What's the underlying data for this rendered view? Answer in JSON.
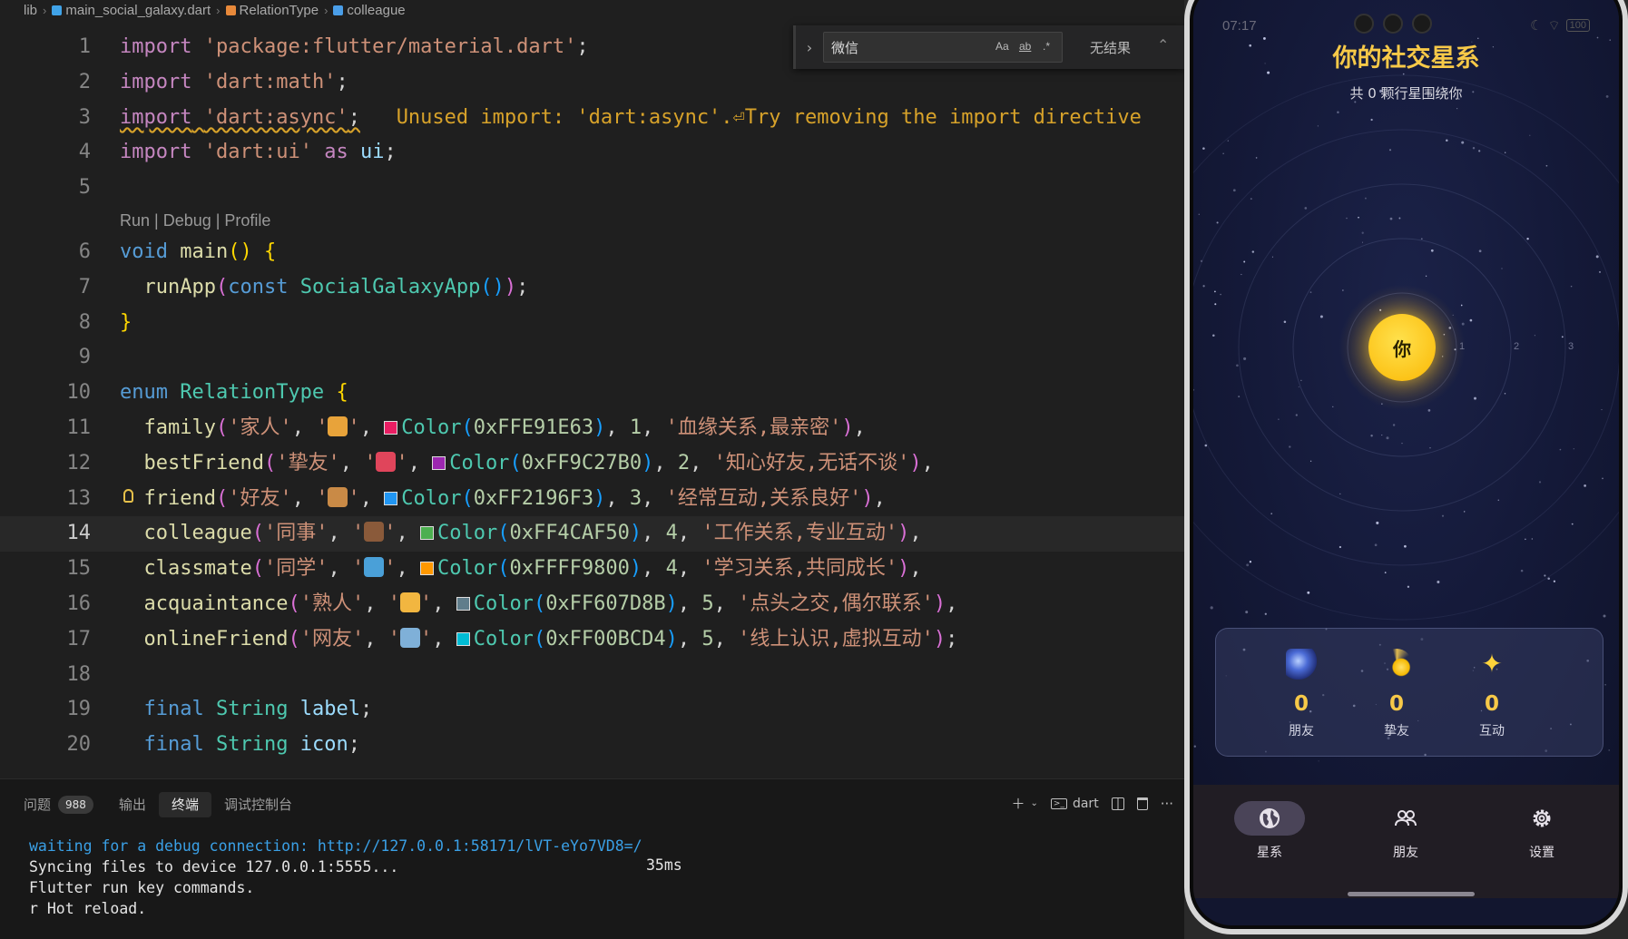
{
  "breadcrumb": [
    "lib",
    "main_social_galaxy.dart",
    "RelationType",
    "colleague"
  ],
  "find": {
    "query": "微信",
    "opt_case": "Aa",
    "opt_word": "ab",
    "opt_regex": ".*",
    "result": "无结果"
  },
  "codelens": "Run | Debug | Profile",
  "line_numbers": [
    "1",
    "2",
    "3",
    "4",
    "5",
    "6",
    "7",
    "8",
    "9",
    "10",
    "11",
    "12",
    "13",
    "14",
    "15",
    "16",
    "17",
    "18",
    "19",
    "20"
  ],
  "code": {
    "l1": "'package:flutter/material.dart'",
    "l2": "'dart:math'",
    "l3": "'dart:async'",
    "l3_diag": "Unused import: 'dart:async'.⏎Try removing the import directive",
    "l4_str": "'dart:ui'",
    "l4_alias": "ui",
    "l6": "main",
    "l7_fn": "runApp",
    "l7_ty": "SocialGalaxyApp",
    "l10_ty": "RelationType",
    "enum_rows": [
      {
        "name": "family",
        "label": "'家人'",
        "color": "0xFFE91E63",
        "hex": "#E91E63",
        "level": "1",
        "desc": "'血缘关系,最亲密'",
        "emoji_bg": "#e8a33a"
      },
      {
        "name": "bestFriend",
        "label": "'挚友'",
        "color": "0xFF9C27B0",
        "hex": "#9C27B0",
        "level": "2",
        "desc": "'知心好友,无话不谈'",
        "emoji_bg": "#e0455b"
      },
      {
        "name": "friend",
        "label": "'好友'",
        "color": "0xFF2196F3",
        "hex": "#2196F3",
        "level": "3",
        "desc": "'经常互动,关系良好'",
        "emoji_bg": "#c98a46"
      },
      {
        "name": "colleague",
        "label": "'同事'",
        "color": "0xFF4CAF50",
        "hex": "#4CAF50",
        "level": "4",
        "desc": "'工作关系,专业互动'",
        "emoji_bg": "#8a5a3a"
      },
      {
        "name": "classmate",
        "label": "'同学'",
        "color": "0xFFFF9800",
        "hex": "#FF9800",
        "level": "4",
        "desc": "'学习关系,共同成长'",
        "emoji_bg": "#4aa0d8"
      },
      {
        "name": "acquaintance",
        "label": "'熟人'",
        "color": "0xFF607D8B",
        "hex": "#607D8B",
        "level": "5",
        "desc": "'点头之交,偶尔联系'",
        "emoji_bg": "#f2b640"
      },
      {
        "name": "onlineFriend",
        "label": "'网友'",
        "color": "0xFF00BCD4",
        "hex": "#00BCD4",
        "level": "5",
        "desc": "'线上认识,虚拟互动'",
        "emoji_bg": "#7fb0d8"
      }
    ],
    "l19": "label",
    "l20": "icon"
  },
  "panel": {
    "tabs": [
      "问题",
      "输出",
      "终端",
      "调试控制台"
    ],
    "problems_count": "988",
    "active_tab": "终端",
    "shell": "dart",
    "term_lines": [
      "waiting for a debug connection: http://127.0.0.1:58171/lVT-eYo7VD8=/",
      "Syncing files to device 127.0.0.1:5555...",
      "",
      "Flutter run key commands.",
      "r Hot reload."
    ],
    "term_timing": "35ms"
  },
  "phone": {
    "time": "07:17",
    "battery": "100",
    "title": "你的社交星系",
    "subtitle": "共 0 颗行星围绕你",
    "sun_label": "你",
    "orbit_labels": [
      "1",
      "2",
      "3"
    ],
    "stats": [
      {
        "value": "0",
        "label": "朋友",
        "icon": "galaxy-icon"
      },
      {
        "value": "0",
        "label": "挚友",
        "icon": "comet-icon"
      },
      {
        "value": "0",
        "label": "互动",
        "icon": "sparkles-icon"
      }
    ],
    "nav": [
      {
        "label": "星系",
        "icon": "globe-icon",
        "active": true
      },
      {
        "label": "朋友",
        "icon": "people-icon",
        "active": false
      },
      {
        "label": "设置",
        "icon": "gear-icon",
        "active": false
      }
    ],
    "colors": {
      "accent": "#f7c948",
      "sun": "#fcc419",
      "nav_bg": "#211d24",
      "nav_pill": "#4a4458"
    }
  }
}
